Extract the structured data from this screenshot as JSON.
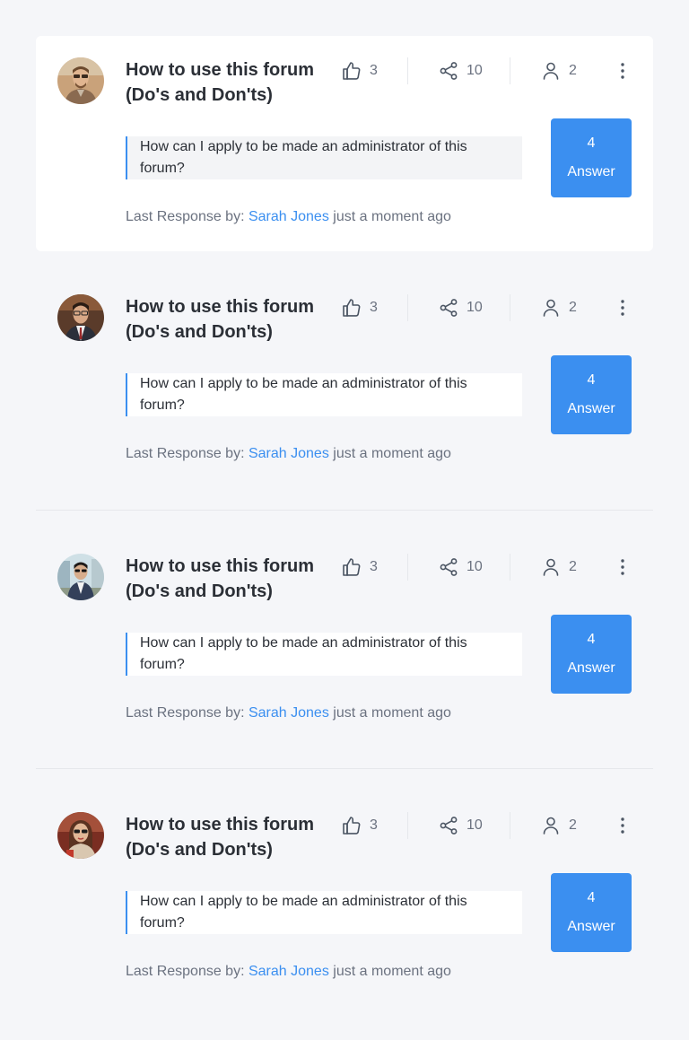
{
  "posts": [
    {
      "title_line1": "How to use this forum",
      "title_line2": "(Do's and Don'ts)",
      "likes": "3",
      "shares": "10",
      "participants": "2",
      "excerpt": "How can I apply to be made an administrator of this forum?",
      "answer_count": "4",
      "answer_label": "Answer",
      "last_response_prefix": "Last Response by:",
      "last_response_author": "Sarah Jones",
      "last_response_time": "just a moment ago"
    },
    {
      "title_line1": "How to use this forum",
      "title_line2": "(Do's and Don'ts)",
      "likes": "3",
      "shares": "10",
      "participants": "2",
      "excerpt": "How can I apply to be made an administrator of this forum?",
      "answer_count": "4",
      "answer_label": "Answer",
      "last_response_prefix": "Last Response by:",
      "last_response_author": "Sarah Jones",
      "last_response_time": "just a moment ago"
    },
    {
      "title_line1": "How to use this forum",
      "title_line2": "(Do's and Don'ts)",
      "likes": "3",
      "shares": "10",
      "participants": "2",
      "excerpt": "How can I apply to be made an administrator of this forum?",
      "answer_count": "4",
      "answer_label": "Answer",
      "last_response_prefix": "Last Response by:",
      "last_response_author": "Sarah Jones",
      "last_response_time": "just a moment ago"
    },
    {
      "title_line1": "How to use this forum",
      "title_line2": "(Do's and Don'ts)",
      "likes": "3",
      "shares": "10",
      "participants": "2",
      "excerpt": "How can I apply to be made an administrator of this forum?",
      "answer_count": "4",
      "answer_label": "Answer",
      "last_response_prefix": "Last Response by:",
      "last_response_author": "Sarah Jones",
      "last_response_time": "just a moment ago"
    }
  ],
  "icons": {
    "likes": "thumbs-up-icon",
    "shares": "share-icon",
    "participants": "user-icon",
    "more": "more-vertical-icon"
  },
  "colors": {
    "accent": "#3b8ff0",
    "background": "#f5f6f9",
    "card": "#ffffff",
    "text": "#2b2f36",
    "muted": "#6b7280"
  }
}
